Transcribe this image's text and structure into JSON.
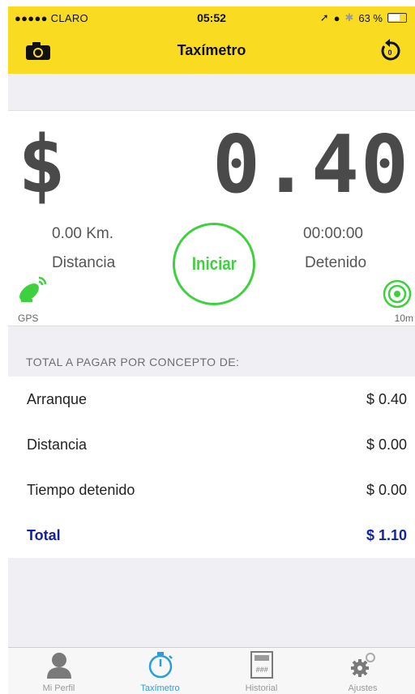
{
  "status_bar": {
    "carrier": "●●●●● CLARO",
    "time": "05:52",
    "battery": "63 %",
    "battery_level": 0.63
  },
  "nav": {
    "title": "Taxímetro",
    "camera_icon": "camera-icon",
    "reset_icon": "reset-icon"
  },
  "meter": {
    "currency": "$",
    "amount": "0.40",
    "distance_value": "0.00 Km.",
    "distance_label": "Distancia",
    "time_value": "00:00:00",
    "time_label": "Detenido",
    "start_label": "Iniciar",
    "gps_label": "GPS",
    "accuracy_label": "10m"
  },
  "breakdown": {
    "header": "TOTAL A PAGAR POR CONCEPTO DE:",
    "rows": [
      {
        "name": "Arranque",
        "value": "$ 0.40"
      },
      {
        "name": "Distancia",
        "value": "$ 0.00"
      },
      {
        "name": "Tiempo detenido",
        "value": "$ 0.00"
      }
    ],
    "total": {
      "name": "Total",
      "value": "$ 1.10"
    }
  },
  "tabs": [
    {
      "label": "Mi Perfil",
      "icon": "profile-icon"
    },
    {
      "label": "Taxímetro",
      "icon": "stopwatch-icon"
    },
    {
      "label": "Historial",
      "icon": "history-icon"
    },
    {
      "label": "Ajustes",
      "icon": "settings-icon"
    }
  ],
  "colors": {
    "accent_yellow": "#f9dc21",
    "start_green": "#3ed13e",
    "total_blue": "#1122aa",
    "tab_active": "#2a9fd6"
  }
}
